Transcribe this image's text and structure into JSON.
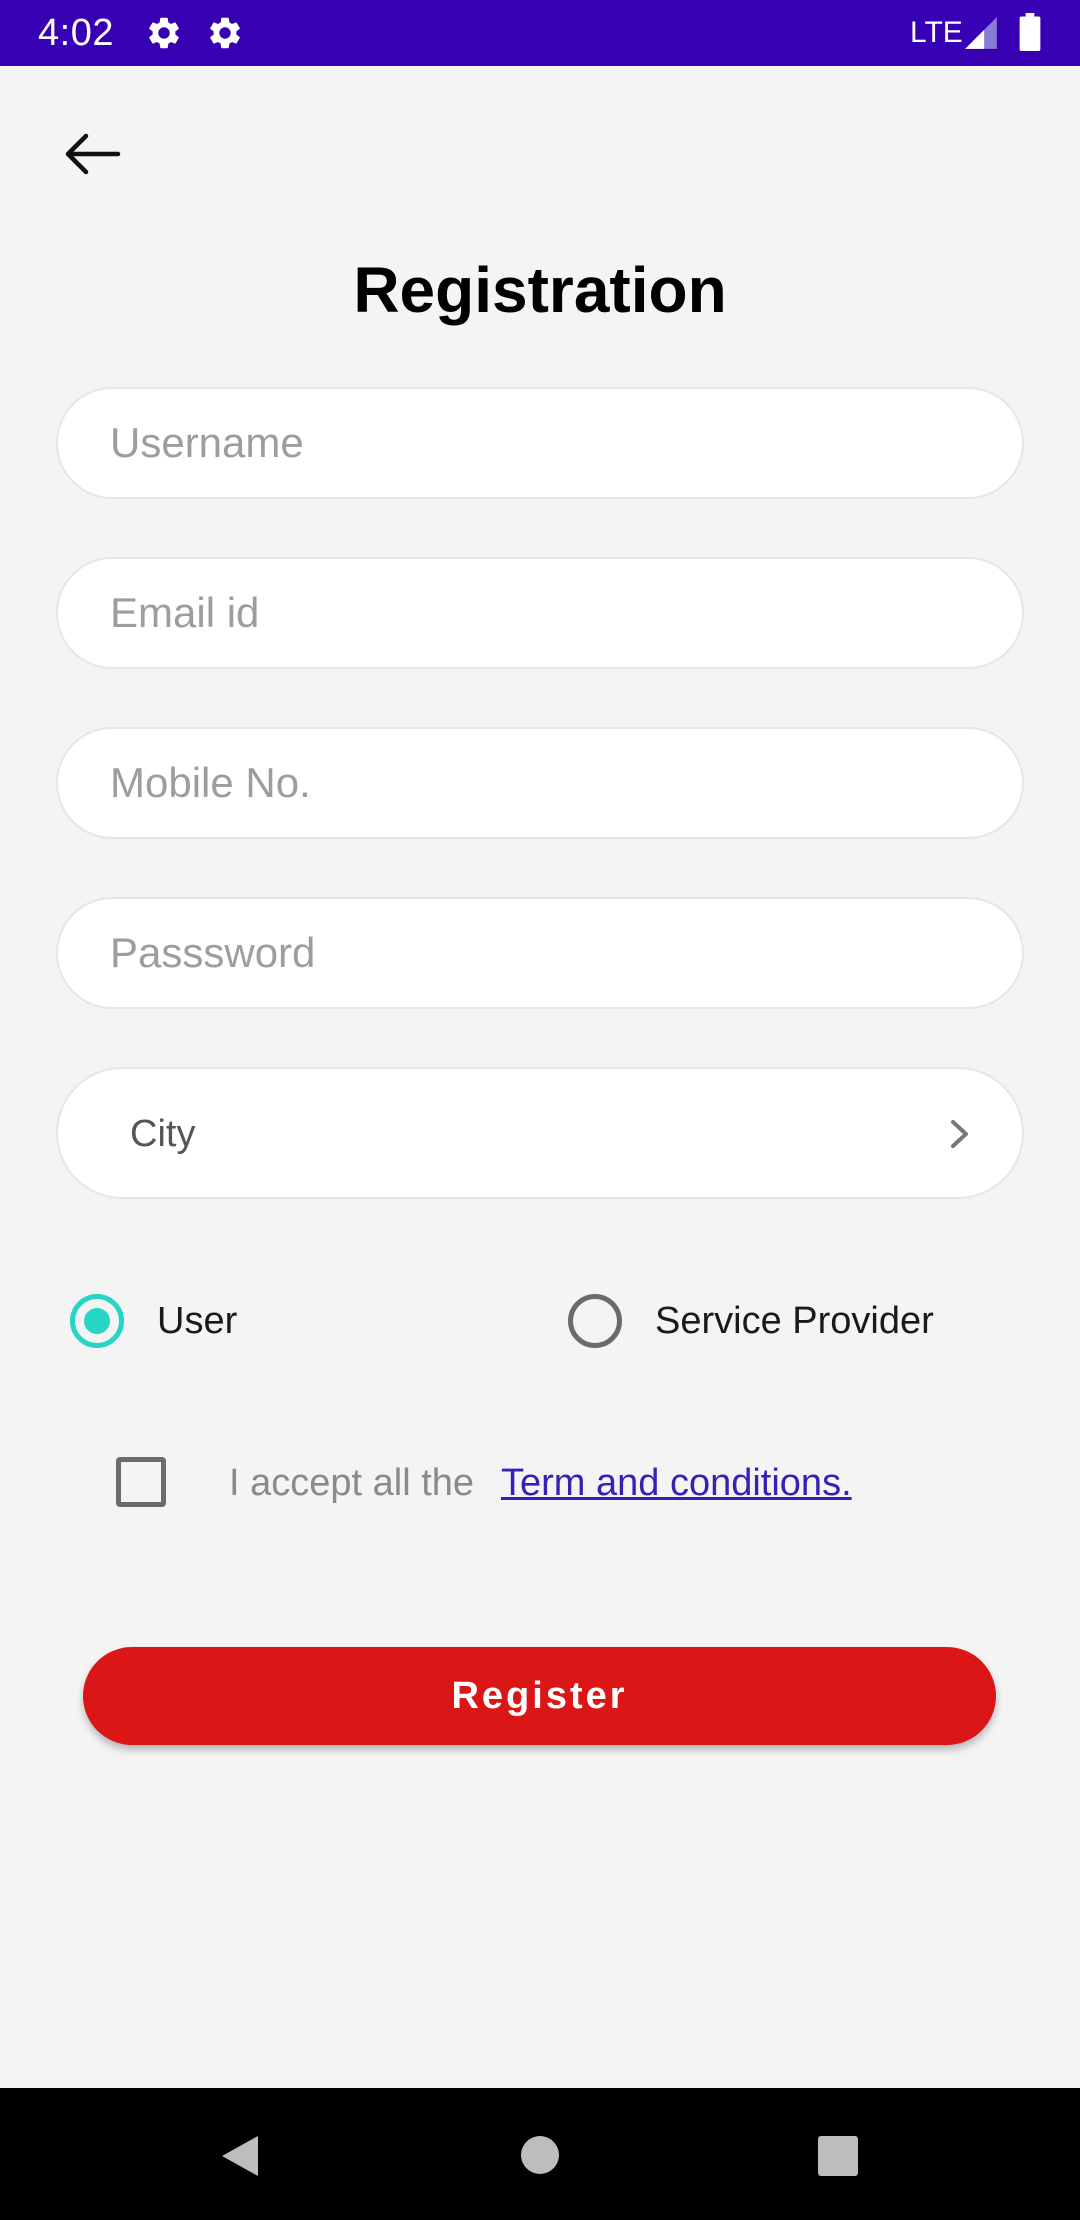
{
  "status_bar": {
    "time": "4:02",
    "network": "LTE",
    "icons": [
      "gear-icon",
      "gear-icon",
      "signal-icon",
      "battery-icon"
    ],
    "color": "#3700b3"
  },
  "header": {
    "back_icon": "arrow-left-icon",
    "title": "Registration"
  },
  "form": {
    "username": {
      "placeholder": "Username",
      "value": ""
    },
    "email": {
      "placeholder": "Email id",
      "value": ""
    },
    "mobile": {
      "placeholder": "Mobile No.",
      "value": ""
    },
    "password": {
      "placeholder": "Passsword",
      "value": ""
    },
    "city": {
      "label": "City",
      "icon": "chevron-right-icon"
    }
  },
  "account_type": {
    "options": [
      {
        "label": "User",
        "selected": true
      },
      {
        "label": "Service Provider",
        "selected": false
      }
    ],
    "accent_color": "#26d5c4"
  },
  "terms": {
    "checked": false,
    "text": "I accept all the",
    "link": "Term and conditions."
  },
  "register_button": {
    "label": "Register",
    "color": "#da1616"
  },
  "nav_bar": {
    "icons": [
      "nav-back-icon",
      "nav-home-icon",
      "nav-recents-icon"
    ]
  }
}
